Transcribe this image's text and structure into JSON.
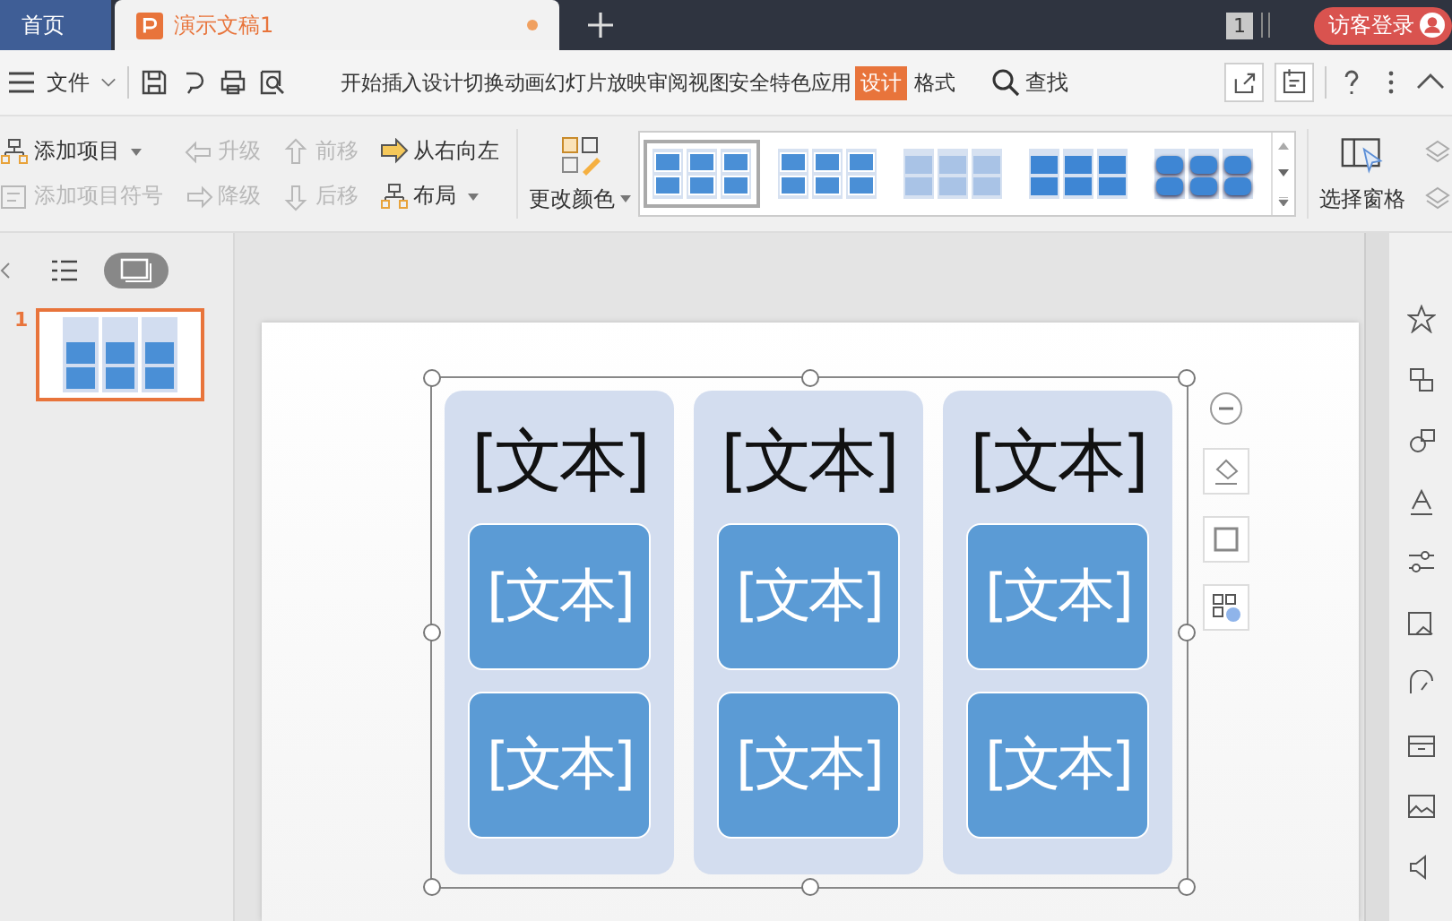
{
  "tabs": [
    {
      "label": "首页",
      "selected": false
    },
    {
      "label": "演示文稿1",
      "selected": true,
      "unsaved": true
    }
  ],
  "window_count": "1",
  "login_button": "访客登录",
  "menu": {
    "file": "文件",
    "ribbon_tabs": [
      {
        "label": "开始",
        "selected": false
      },
      {
        "label": "插入",
        "selected": false
      },
      {
        "label": "设计",
        "selected": false
      },
      {
        "label": "切换",
        "selected": false
      },
      {
        "label": "动画",
        "selected": false
      },
      {
        "label": "幻灯片放映",
        "selected": false
      },
      {
        "label": "审阅",
        "selected": false
      },
      {
        "label": "视图",
        "selected": false
      },
      {
        "label": "安全",
        "selected": false
      },
      {
        "label": "特色应用",
        "selected": false
      },
      {
        "label": "设计",
        "selected": true
      },
      {
        "label": "格式",
        "selected": false
      }
    ],
    "search": "查找"
  },
  "ribbon": {
    "tools": [
      {
        "label": "添加项目",
        "disabled": false,
        "dropdown": true
      },
      {
        "label": "添加项目符号",
        "disabled": true,
        "dropdown": false
      },
      {
        "label": "升级",
        "disabled": true,
        "dropdown": false
      },
      {
        "label": "降级",
        "disabled": true,
        "dropdown": false
      },
      {
        "label": "前移",
        "disabled": true,
        "dropdown": false
      },
      {
        "label": "后移",
        "disabled": true,
        "dropdown": false
      },
      {
        "label": "从右向左",
        "disabled": false,
        "dropdown": false
      },
      {
        "label": "布局",
        "disabled": false,
        "dropdown": true
      }
    ],
    "change_color": "更改颜色",
    "styles": [
      {
        "selected": true
      },
      {
        "selected": false
      },
      {
        "selected": false
      },
      {
        "selected": false
      },
      {
        "selected": false
      }
    ],
    "selection_pane": "选择窗格"
  },
  "view_modes": [
    {
      "selected": false
    },
    {
      "selected": true
    }
  ],
  "slides": [
    {
      "number": "1",
      "selected": true
    }
  ],
  "slide": {
    "columns": [
      {
        "header": "[文本]",
        "items": [
          "[文本]",
          "[文本]"
        ]
      },
      {
        "header": "[文本]",
        "items": [
          "[文本]",
          "[文本]"
        ]
      },
      {
        "header": "[文本]",
        "items": [
          "[文本]",
          "[文本]"
        ]
      }
    ]
  }
}
